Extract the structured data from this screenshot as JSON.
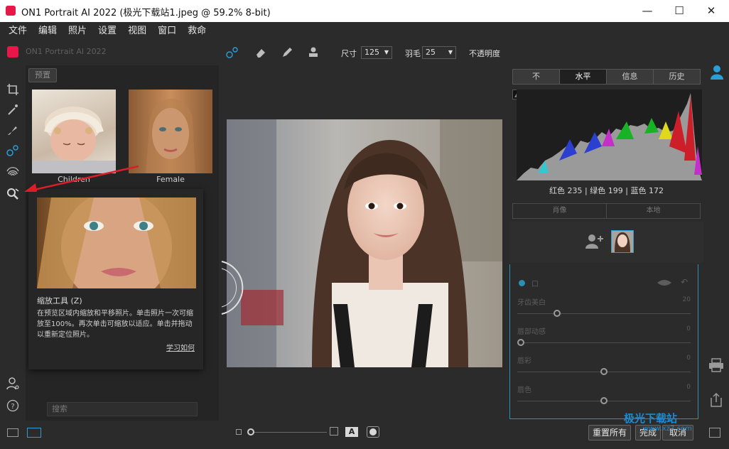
{
  "window": {
    "title": "ON1 Portrait AI 2022 (极光下载站1.jpeg @ 59.2% 8-bit)",
    "minimize": "—",
    "maximize": "☐",
    "close": "✕"
  },
  "menu": [
    "文件",
    "编辑",
    "照片",
    "设置",
    "视图",
    "窗口",
    "救命"
  ],
  "brand": "ON1 Portrait AI 2022",
  "presets": {
    "tab_label": "预置",
    "items": [
      {
        "label": "Children"
      },
      {
        "label": "Female"
      }
    ]
  },
  "tooltip": {
    "title": "缩放工具 (Z)",
    "body": "在预览区域内缩放和平移照片。单击照片一次可缩放至100%。再次单击可缩放以适应。单击并拖动以重新定位照片。",
    "link": "学习如何"
  },
  "search": {
    "placeholder": "搜索"
  },
  "toolbar": {
    "size_label": "尺寸",
    "size_value": "125",
    "feather_label": "羽毛",
    "feather_value": "25",
    "opacity_label": "不透明度"
  },
  "right": {
    "tabs": [
      "不",
      "水平",
      "信息",
      "历史"
    ],
    "active_tab": 1,
    "rgb_readout": "红色 235 | 绿色 199 | 蓝色 172",
    "seg": [
      "肖像",
      "本地"
    ],
    "adjust": {
      "header": "口",
      "items": [
        {
          "label": "牙齿美白",
          "value": "20",
          "level": 0.22
        },
        {
          "label": "唇部动感",
          "value": "0",
          "level": 0.0
        },
        {
          "label": "唇彩",
          "value": "0",
          "level": 0.5
        },
        {
          "label": "唇色",
          "value": "0",
          "level": 0.5
        }
      ]
    }
  },
  "bottom": {
    "reset": "重置所有",
    "done": "完成",
    "cancel": "取消",
    "view_mode": "A"
  },
  "watermark": {
    "main": "极光下载站",
    "sub": "www.xz7.com"
  },
  "colors": {
    "accent": "#2a8fb0",
    "brand": "#e8174a",
    "arrow": "#d81e2a"
  }
}
